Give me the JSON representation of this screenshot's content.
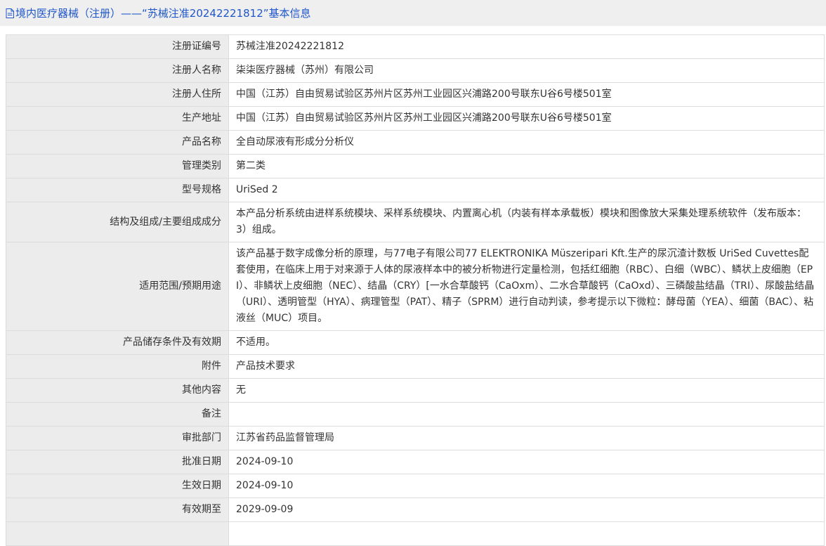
{
  "header": {
    "title": "境内医疗器械（注册）——“苏械注准20242221812”基本信息"
  },
  "rows": [
    {
      "label": "注册证编号",
      "value": "苏械注准20242221812"
    },
    {
      "label": "注册人名称",
      "value": "柒柒医疗器械（苏州）有限公司"
    },
    {
      "label": "注册人住所",
      "value": "中国（江苏）自由贸易试验区苏州片区苏州工业园区兴浦路200号联东U谷6号楼501室"
    },
    {
      "label": "生产地址",
      "value": "中国（江苏）自由贸易试验区苏州片区苏州工业园区兴浦路200号联东U谷6号楼501室"
    },
    {
      "label": "产品名称",
      "value": "全自动尿液有形成分分析仪"
    },
    {
      "label": "管理类别",
      "value": "第二类"
    },
    {
      "label": "型号规格",
      "value": "UriSed 2"
    },
    {
      "label": "结构及组成/主要组成成分",
      "value": "本产品分析系统由进样系统模块、采样系统模块、内置离心机（内装有样本承载板）模块和图像放大采集处理系统软件（发布版本：3）组成。"
    },
    {
      "label": "适用范围/预期用途",
      "value": "该产品基于数字成像分析的原理，与77电子有限公司77 ELEKTRONIKA Müszeripari Kft.生产的尿沉渣计数板 UriSed Cuvettes配套使用，在临床上用于对来源于人体的尿液样本中的被分析物进行定量检测，包括红细胞（RBC）、白细（WBC）、鳞状上皮细胞（EPI）、非鳞状上皮细胞（NEC）、结晶（CRY）[一水合草酸钙（CaOxm）、二水合草酸钙（CaOxd）、三磷酸盐结晶（TRI）、尿酸盐结晶（URI）、透明管型（HYA）、病理管型（PAT）、精子（SPRM）进行自动判读，参考提示以下微粒：酵母菌（YEA）、细菌（BAC）、粘液丝（MUC）项目。"
    },
    {
      "label": "产品储存条件及有效期",
      "value": "不适用。"
    },
    {
      "label": "附件",
      "value": "产品技术要求"
    },
    {
      "label": "其他内容",
      "value": "无"
    },
    {
      "label": "备注",
      "value": ""
    },
    {
      "label": "审批部门",
      "value": "江苏省药品监督管理局"
    },
    {
      "label": "批准日期",
      "value": "2024-09-10"
    },
    {
      "label": "生效日期",
      "value": "2024-09-10"
    },
    {
      "label": "有效期至",
      "value": "2029-09-09"
    },
    {
      "label": "",
      "value": ""
    }
  ],
  "colors": {
    "link": "#1f56c9",
    "header_bg": "#efefef",
    "label_bg": "#ececec",
    "border": "#dcdcdc"
  },
  "icons": {
    "header_icon": "document-icon"
  }
}
